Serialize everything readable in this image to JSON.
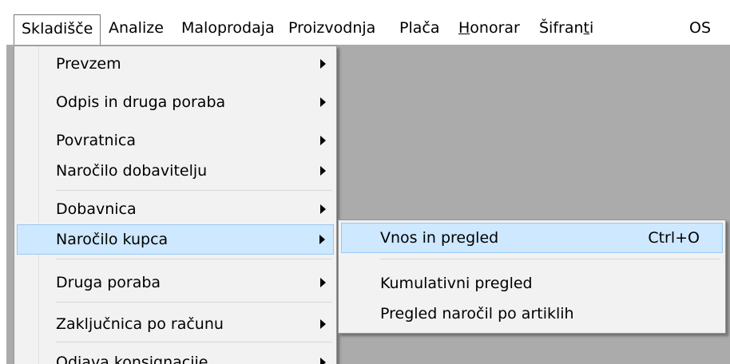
{
  "menubar": {
    "items": [
      {
        "label": "Skladišče"
      },
      {
        "label": "Analize"
      },
      {
        "label": "Maloprodaja"
      },
      {
        "label": "Proizvodnja"
      },
      {
        "label": "Plača"
      },
      {
        "label_pre": "",
        "label_ul": "H",
        "label_post": "onorar"
      },
      {
        "label_pre": "Šifran",
        "label_ul": "t",
        "label_post": "i"
      },
      {
        "label": "OS"
      }
    ]
  },
  "menu": {
    "items": [
      {
        "label": "Prevzem",
        "submenu": true
      },
      {
        "label": "Odpis in druga poraba",
        "submenu": true
      },
      {
        "label": "Povratnica",
        "submenu": true
      },
      {
        "label": "Naročilo dobavitelju",
        "submenu": true
      },
      {
        "label": "Dobavnica",
        "submenu": true
      },
      {
        "label": "Naročilo kupca",
        "submenu": true,
        "highlighted": true
      },
      {
        "label": "Druga poraba",
        "submenu": true
      },
      {
        "label": "Zaključnica po računu",
        "submenu": true
      },
      {
        "label": "Odjava konsignacije",
        "submenu": true
      }
    ]
  },
  "submenu": {
    "items": [
      {
        "label": "Vnos in pregled",
        "shortcut": "Ctrl+O",
        "highlighted": true
      },
      {
        "label": "Kumulativni pregled"
      },
      {
        "label": "Pregled naročil po artiklih"
      }
    ]
  },
  "colors": {
    "workspace": "#ababab",
    "menu_bg": "#f2f2f2",
    "highlight_bg": "#cde8ff",
    "highlight_border": "#9ac8ef"
  }
}
